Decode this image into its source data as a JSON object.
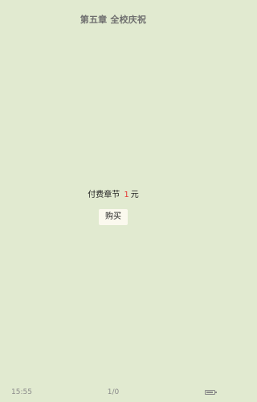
{
  "chapter": {
    "title": "第五章 全校庆祝"
  },
  "paywall": {
    "label": "付费章节",
    "price": "1",
    "unit": "元",
    "buy_label": "购买"
  },
  "status": {
    "time": "15:55",
    "page_indicator": "1/0",
    "battery_level": 0.9,
    "battery_icon": "battery-icon"
  }
}
